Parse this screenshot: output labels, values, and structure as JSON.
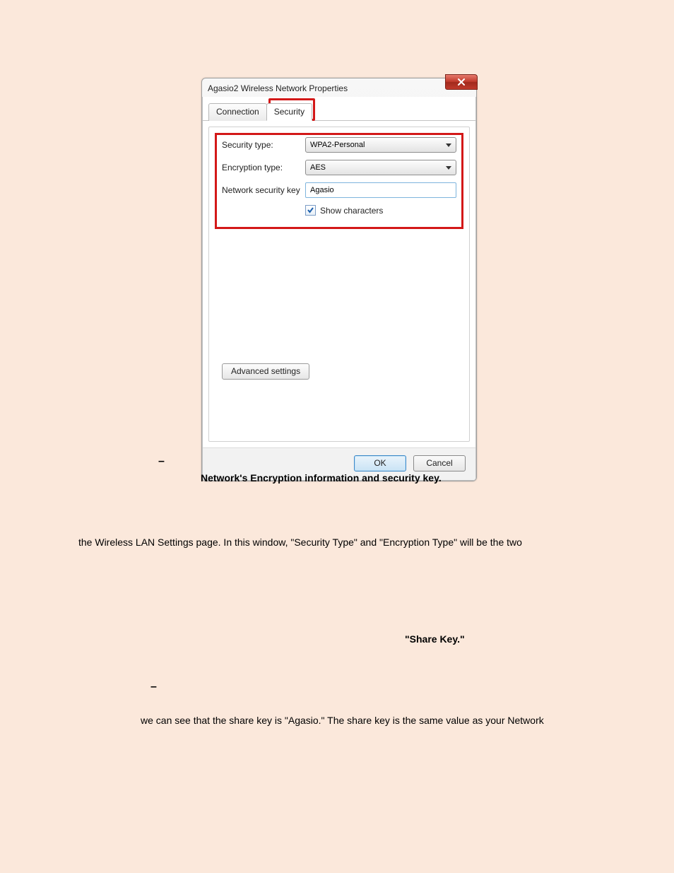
{
  "dialog": {
    "title": "Agasio2 Wireless Network Properties",
    "tabs": {
      "connection": "Connection",
      "security": "Security"
    },
    "form": {
      "security_type_label": "Security type:",
      "security_type_value": "WPA2-Personal",
      "encryption_type_label": "Encryption type:",
      "encryption_type_value": "AES",
      "network_key_label": "Network security key",
      "network_key_value": "Agasio",
      "show_characters_label": "Show characters"
    },
    "advanced_button": "Advanced settings",
    "ok_button": "OK",
    "cancel_button": "Cancel"
  },
  "doc": {
    "caption": "Network's Encryption information and security key.",
    "line2": "the Wireless LAN Settings page. In this window, \"Security Type\" and \"Encryption Type\" will be the two",
    "share_key_bold": "\"Share Key.\"",
    "line3": "we can see that the share key is \"Agasio.\" The share key is the same value as your Network",
    "dash": "–"
  }
}
